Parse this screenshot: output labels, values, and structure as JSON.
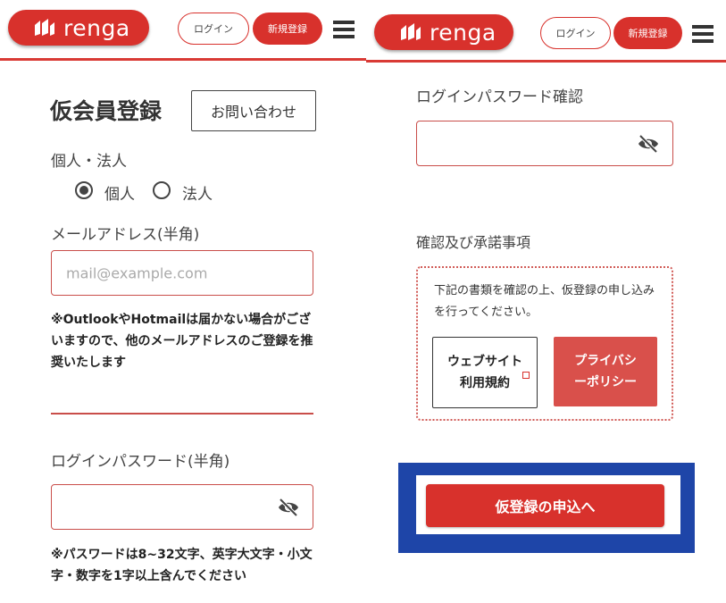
{
  "header": {
    "logo_text": "renga",
    "login_label": "ログイン",
    "signup_label": "新規登録"
  },
  "left": {
    "page_title": "仮会員登録",
    "inquiry_label": "お問い合わせ",
    "type_label": "個人・法人",
    "type_options": [
      "個人",
      "法人"
    ],
    "selected_type": "個人",
    "email_label": "メールアドレス(半角)",
    "email_placeholder": "mail@example.com",
    "email_note": "※OutlookやHotmailは届かない場合がございますので、他のメールアドレスのご登録を推奨いたします",
    "password_label": "ログインパスワード(半角)",
    "password_value": "",
    "password_note": "※パスワードは8~32文字、英字大文字・小文字・数字を1字以上含んでください"
  },
  "right": {
    "confirm_label": "ログインパスワード確認",
    "confirm_value": "",
    "consent_heading": "確認及び承諾事項",
    "consent_text": "下記の書類を確認の上、仮登録の申し込みを行ってください。",
    "terms_label": "ウェブサイト利用規約",
    "privacy_label": "プライバシーポリシー",
    "submit_label": "仮登録の申込へ"
  },
  "colors": {
    "brand_red": "#d8312c",
    "highlight_blue": "#1e45a8"
  },
  "icons": [
    "renga-logo-icon",
    "hamburger-menu-icon",
    "eye-off-icon",
    "external-link-icon"
  ]
}
